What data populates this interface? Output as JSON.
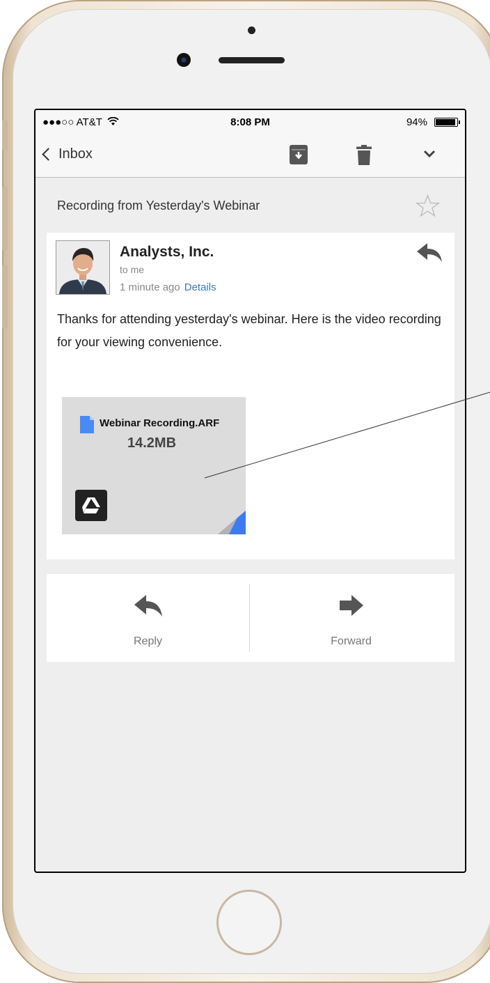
{
  "status_bar": {
    "carrier": "●●●○○ AT&T",
    "time": "8:08 PM",
    "battery": "94%"
  },
  "nav": {
    "back_label": "Inbox",
    "icons": [
      "archive-icon",
      "trash-icon",
      "chevron-down-icon"
    ]
  },
  "email": {
    "subject": "Recording from Yesterday's Webinar",
    "sender": "Analysts, Inc.",
    "to": "to me",
    "time_ago": "1 minute ago",
    "details_link": "Details",
    "body": "Thanks for attending yesterday's webinar. Here is the video recording for your viewing convenience.",
    "attachment": {
      "name": "Webinar Recording.ARF",
      "size": "14.2MB",
      "icons": [
        "file-icon",
        "drive-icon"
      ]
    }
  },
  "actions": {
    "reply_label": "Reply",
    "forward_label": "Forward"
  },
  "colors": {
    "link": "#3b78c8",
    "accent_blue": "#4a8af4",
    "phone_gold": "#cdb89b"
  }
}
